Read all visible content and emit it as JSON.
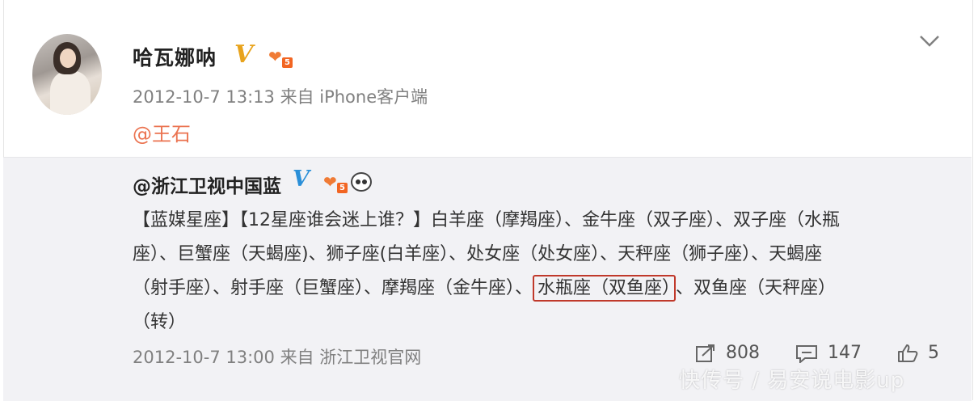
{
  "post": {
    "author": "哈瓦娜呐",
    "level_num": "5",
    "timestamp": "2012-10-7 13:13",
    "source": "来自 iPhone客户端",
    "mention": "@王石"
  },
  "repost": {
    "author": "@浙江卫视中国蓝",
    "level_num": "5",
    "lines": [
      "【蓝媒星座】【12星座谁会迷上谁？】白羊座（摩羯座）、金牛座（双子座）、双子座（水瓶",
      "座）、巨蟹座（天蝎座)、狮子座(白羊座）、处女座（处女座）、天秤座（狮子座）、天蝎座",
      "（射手座）、射手座（巨蟹座）、摩羯座（金牛座）、",
      "水瓶座（双鱼座）",
      "、双鱼座（天秤座）",
      "（转）"
    ],
    "timestamp": "2012-10-7 13:00",
    "source": "来自 浙江卫视官网",
    "repost_count": "808",
    "comment_count": "147",
    "like_count": "5"
  },
  "watermark": "快传号 / 易安说电影up",
  "colors": {
    "accent": "#eb7350",
    "verified_gold": "#e8a31c",
    "verified_blue": "#2a8fd8",
    "highlight_border": "#c0392b",
    "repost_bg": "#f2f2f5"
  },
  "icons": {
    "verified": "verified-v-icon",
    "level": "heart-level-icon",
    "panda": "panda-icon",
    "menu": "chevron-down-icon",
    "repost": "repost-icon",
    "comment": "comment-icon",
    "like": "thumbs-up-icon"
  }
}
